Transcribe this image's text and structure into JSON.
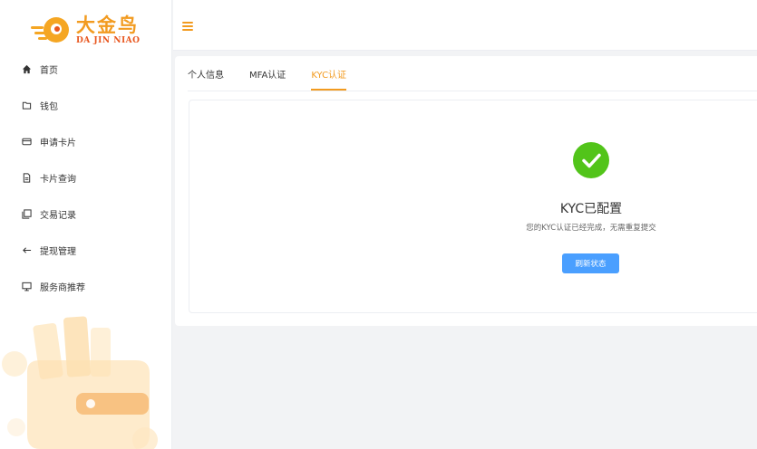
{
  "brand": {
    "name_cn": "大金鸟",
    "name_en": "DA JIN NIAO",
    "accent": "#f29b20"
  },
  "sidebar": {
    "items": [
      {
        "label": "首页",
        "icon": "home-icon"
      },
      {
        "label": "钱包",
        "icon": "folder-icon"
      },
      {
        "label": "申请卡片",
        "icon": "card-icon"
      },
      {
        "label": "卡片查询",
        "icon": "document-icon"
      },
      {
        "label": "交易记录",
        "icon": "records-icon"
      },
      {
        "label": "提现管理",
        "icon": "arrow-left-icon"
      },
      {
        "label": "服务商推荐",
        "icon": "monitor-icon"
      }
    ]
  },
  "tabs": [
    {
      "label": "个人信息",
      "active": false
    },
    {
      "label": "MFA认证",
      "active": false
    },
    {
      "label": "KYC认证",
      "active": true
    }
  ],
  "kyc": {
    "status_icon": "check-circle-icon",
    "title": "KYC已配置",
    "description": "您的KYC认证已经完成，无需重复提交",
    "refresh_label": "刷新状态",
    "success_color": "#52c41a",
    "button_color": "#4a9fff"
  }
}
